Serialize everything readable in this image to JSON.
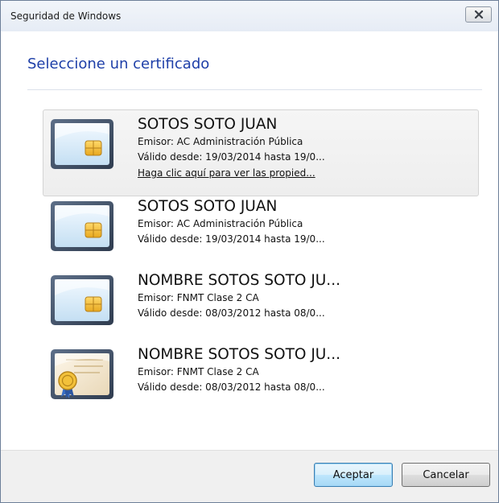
{
  "window": {
    "title": "Seguridad de Windows"
  },
  "dialog": {
    "heading": "Seleccione un certificado"
  },
  "certificates": [
    {
      "name": "SOTOS SOTO JUAN",
      "issuer": "Emisor: AC Administración Pública",
      "validity": "Válido desde: 19/03/2014 hasta 19/0...",
      "link": "Haga clic aquí para ver las propied...",
      "icon": "smartcard-icon",
      "selected": true
    },
    {
      "name": "SOTOS SOTO JUAN",
      "issuer": "Emisor: AC Administración Pública",
      "validity": "Válido desde: 19/03/2014 hasta 19/0...",
      "icon": "smartcard-icon",
      "selected": false
    },
    {
      "name": "NOMBRE SOTOS SOTO JU...",
      "issuer": "Emisor: FNMT Clase 2 CA",
      "validity": "Válido desde: 08/03/2012 hasta 08/0...",
      "icon": "smartcard-icon",
      "selected": false
    },
    {
      "name": "NOMBRE SOTOS SOTO JU...",
      "issuer": "Emisor: FNMT Clase 2 CA",
      "validity": "Válido desde: 08/03/2012 hasta 08/0...",
      "icon": "certificate-seal-icon",
      "selected": false
    }
  ],
  "buttons": {
    "ok": "Aceptar",
    "cancel": "Cancelar"
  },
  "colors": {
    "heading": "#1e3fa8",
    "default_button_border": "#3c7fb1"
  }
}
